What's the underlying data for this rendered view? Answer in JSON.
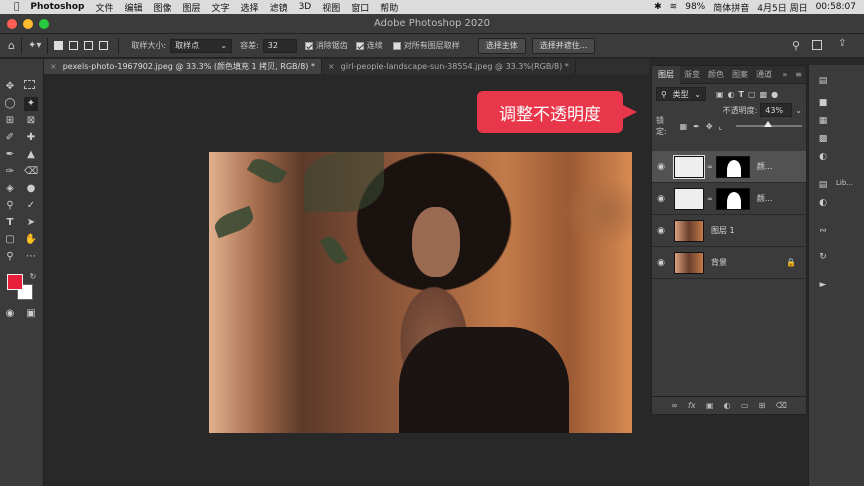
{
  "menubar": {
    "app": "Photoshop",
    "items": [
      "文件",
      "编辑",
      "图像",
      "图层",
      "文字",
      "选择",
      "滤镜",
      "3D",
      "视图",
      "窗口",
      "帮助"
    ],
    "battery": "98%",
    "ime": "简体拼音",
    "date": "4月5日 周日",
    "time": "00:58:07"
  },
  "window": {
    "title": "Adobe Photoshop 2020"
  },
  "options": {
    "sample_size_label": "取样大小:",
    "sample_size_value": "取样点",
    "tolerance_label": "容差:",
    "tolerance_value": "32",
    "antialias_label": "消除锯齿",
    "contiguous_label": "连续",
    "all_layers_label": "对所有图层取样",
    "select_subject": "选择主体",
    "select_mask": "选择并遮住..."
  },
  "doc_tabs": [
    {
      "label": "pexels-photo-1967902.jpeg @ 33.3% (颜色填充 1 拷贝, RGB/8) *"
    },
    {
      "label": "girl-people-landscape-sun-38554.jpeg @ 33.3%(RGB/8) *"
    }
  ],
  "callout": {
    "text": "调整不透明度"
  },
  "layers_panel": {
    "tabs": [
      "图层",
      "渐变",
      "颜色",
      "图案",
      "通道"
    ],
    "filter_type": "类型",
    "opacity_label": "不透明度:",
    "opacity_value": "43%",
    "lock_label": "锁定:",
    "layers": [
      {
        "name": "颜...",
        "type": "fill"
      },
      {
        "name": "颜...",
        "type": "fill"
      },
      {
        "name": "图层 1",
        "type": "photo"
      },
      {
        "name": "背景",
        "type": "photo"
      }
    ],
    "footer_icons": [
      "link-icon",
      "fx-icon",
      "mask-icon",
      "adjust-icon",
      "folder-icon",
      "new-layer-icon",
      "trash-icon"
    ]
  },
  "right_strip": {
    "lib_label": "Lib..."
  },
  "colors": {
    "foreground": "#e8203a",
    "background": "#ffffff",
    "accent_red": "#e8374a"
  }
}
